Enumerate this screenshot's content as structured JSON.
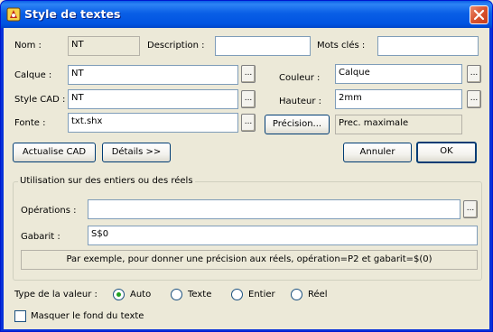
{
  "window": {
    "title": "Style de textes",
    "close_glyph": "✕"
  },
  "row1": {
    "nom_label": "Nom :",
    "nom_value": "NT",
    "description_label": "Description :",
    "description_value": "",
    "mots_cles_label": "Mots clés :",
    "mots_cles_value": ""
  },
  "calque": {
    "label": "Calque :",
    "value": "NT",
    "browse": "..."
  },
  "style_cad": {
    "label": "Style CAD :",
    "value": "NT",
    "browse": "..."
  },
  "fonte": {
    "label": "Fonte :",
    "value": "txt.shx",
    "browse": "..."
  },
  "couleur": {
    "label": "Couleur :",
    "value": "Calque",
    "browse": "..."
  },
  "hauteur": {
    "label": "Hauteur :",
    "value": "2mm",
    "browse": "..."
  },
  "precision": {
    "button": "Précision...",
    "value": "Prec. maximale"
  },
  "buttons": {
    "actualise": "Actualise CAD",
    "details": "Détails >>",
    "annuler": "Annuler",
    "ok": "OK"
  },
  "group": {
    "title": "Utilisation sur des entiers ou des réels",
    "operations_label": "Opérations :",
    "operations_value": "",
    "browse": "...",
    "gabarit_label": "Gabarit :",
    "gabarit_value": "S$0",
    "hint": "Par exemple, pour donner une précision aux réels, opération=P2 et gabarit=$(0)"
  },
  "value_type": {
    "label": "Type de la valeur :",
    "options": [
      "Auto",
      "Texte",
      "Entier",
      "Réel"
    ],
    "selected": "Auto"
  },
  "masquer": {
    "label": "Masquer le fond du texte",
    "checked": false
  }
}
